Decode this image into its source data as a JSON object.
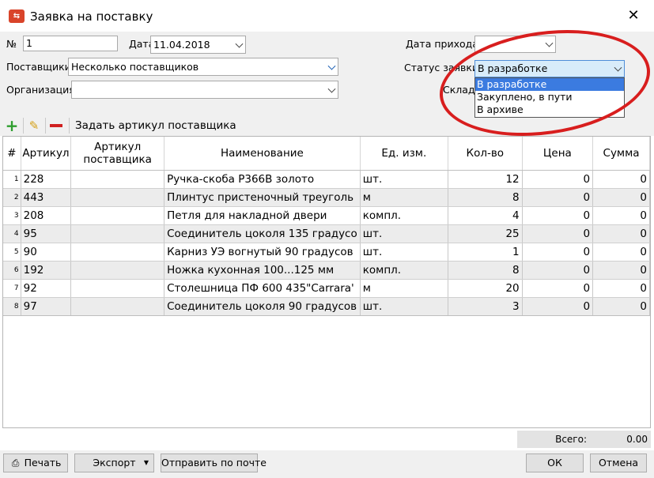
{
  "window": {
    "title": "Заявка на поставку",
    "app_icon": "app-logo-icon"
  },
  "form": {
    "number_label": "№",
    "number_value": "1",
    "date_label": "Дата",
    "date_value": "11.04.2018",
    "arrival_date_label": "Дата прихода",
    "arrival_date_value": "",
    "suppliers_label": "Поставщики",
    "suppliers_value": "Несколько поставщиков",
    "status_label": "Статус заявки",
    "status_value": "В разработке",
    "organization_label": "Организация",
    "organization_value": "",
    "warehouse_label": "Склад"
  },
  "status_dropdown": {
    "options": [
      "В разработке",
      "Закуплено, в пути",
      "В архиве"
    ],
    "selected_index": 0
  },
  "toolbar": {
    "set_supplier_article_label": "Задать артикул поставщика"
  },
  "table": {
    "columns": [
      "#",
      "Артикул",
      "Артикул поставщика",
      "Наименование",
      "Ед. изм.",
      "Кол-во",
      "Цена",
      "Сумма"
    ],
    "rows": [
      {
        "n": "1",
        "article": "228",
        "supplier_article": "",
        "name": "Ручка-скоба Р366В золото",
        "unit": "шт.",
        "qty": "12",
        "price": "0",
        "sum": "0"
      },
      {
        "n": "2",
        "article": "443",
        "supplier_article": "",
        "name": "Плинтус пристеночный треуголь",
        "unit": "м",
        "qty": "8",
        "price": "0",
        "sum": "0"
      },
      {
        "n": "3",
        "article": "208",
        "supplier_article": "",
        "name": "Петля для накладной двери",
        "unit": "компл.",
        "qty": "4",
        "price": "0",
        "sum": "0"
      },
      {
        "n": "4",
        "article": "95",
        "supplier_article": "",
        "name": "Соединитель цоколя 135 градусо",
        "unit": "шт.",
        "qty": "25",
        "price": "0",
        "sum": "0"
      },
      {
        "n": "5",
        "article": "90",
        "supplier_article": "",
        "name": "Карниз УЭ вогнутый 90 градусов",
        "unit": "шт.",
        "qty": "1",
        "price": "0",
        "sum": "0"
      },
      {
        "n": "6",
        "article": "192",
        "supplier_article": "",
        "name": "Ножка кухонная 100...125 мм",
        "unit": "компл.",
        "qty": "8",
        "price": "0",
        "sum": "0"
      },
      {
        "n": "7",
        "article": "92",
        "supplier_article": "",
        "name": "Столешница ПФ 600 435\"Carrara'",
        "unit": "м",
        "qty": "20",
        "price": "0",
        "sum": "0"
      },
      {
        "n": "8",
        "article": "97",
        "supplier_article": "",
        "name": "Соединитель цоколя 90 градусов",
        "unit": "шт.",
        "qty": "3",
        "price": "0",
        "sum": "0"
      }
    ]
  },
  "totals": {
    "label": "Всего:",
    "value": "0.00"
  },
  "buttons": {
    "print": "Печать",
    "export": "Экспорт",
    "send_email": "Отправить по почте",
    "ok": "ОК",
    "cancel": "Отмена"
  },
  "colors": {
    "annotation_oval": "#d81e1e",
    "selection": "#3b7be0",
    "add": "#2e9e2e",
    "remove": "#d02020"
  }
}
